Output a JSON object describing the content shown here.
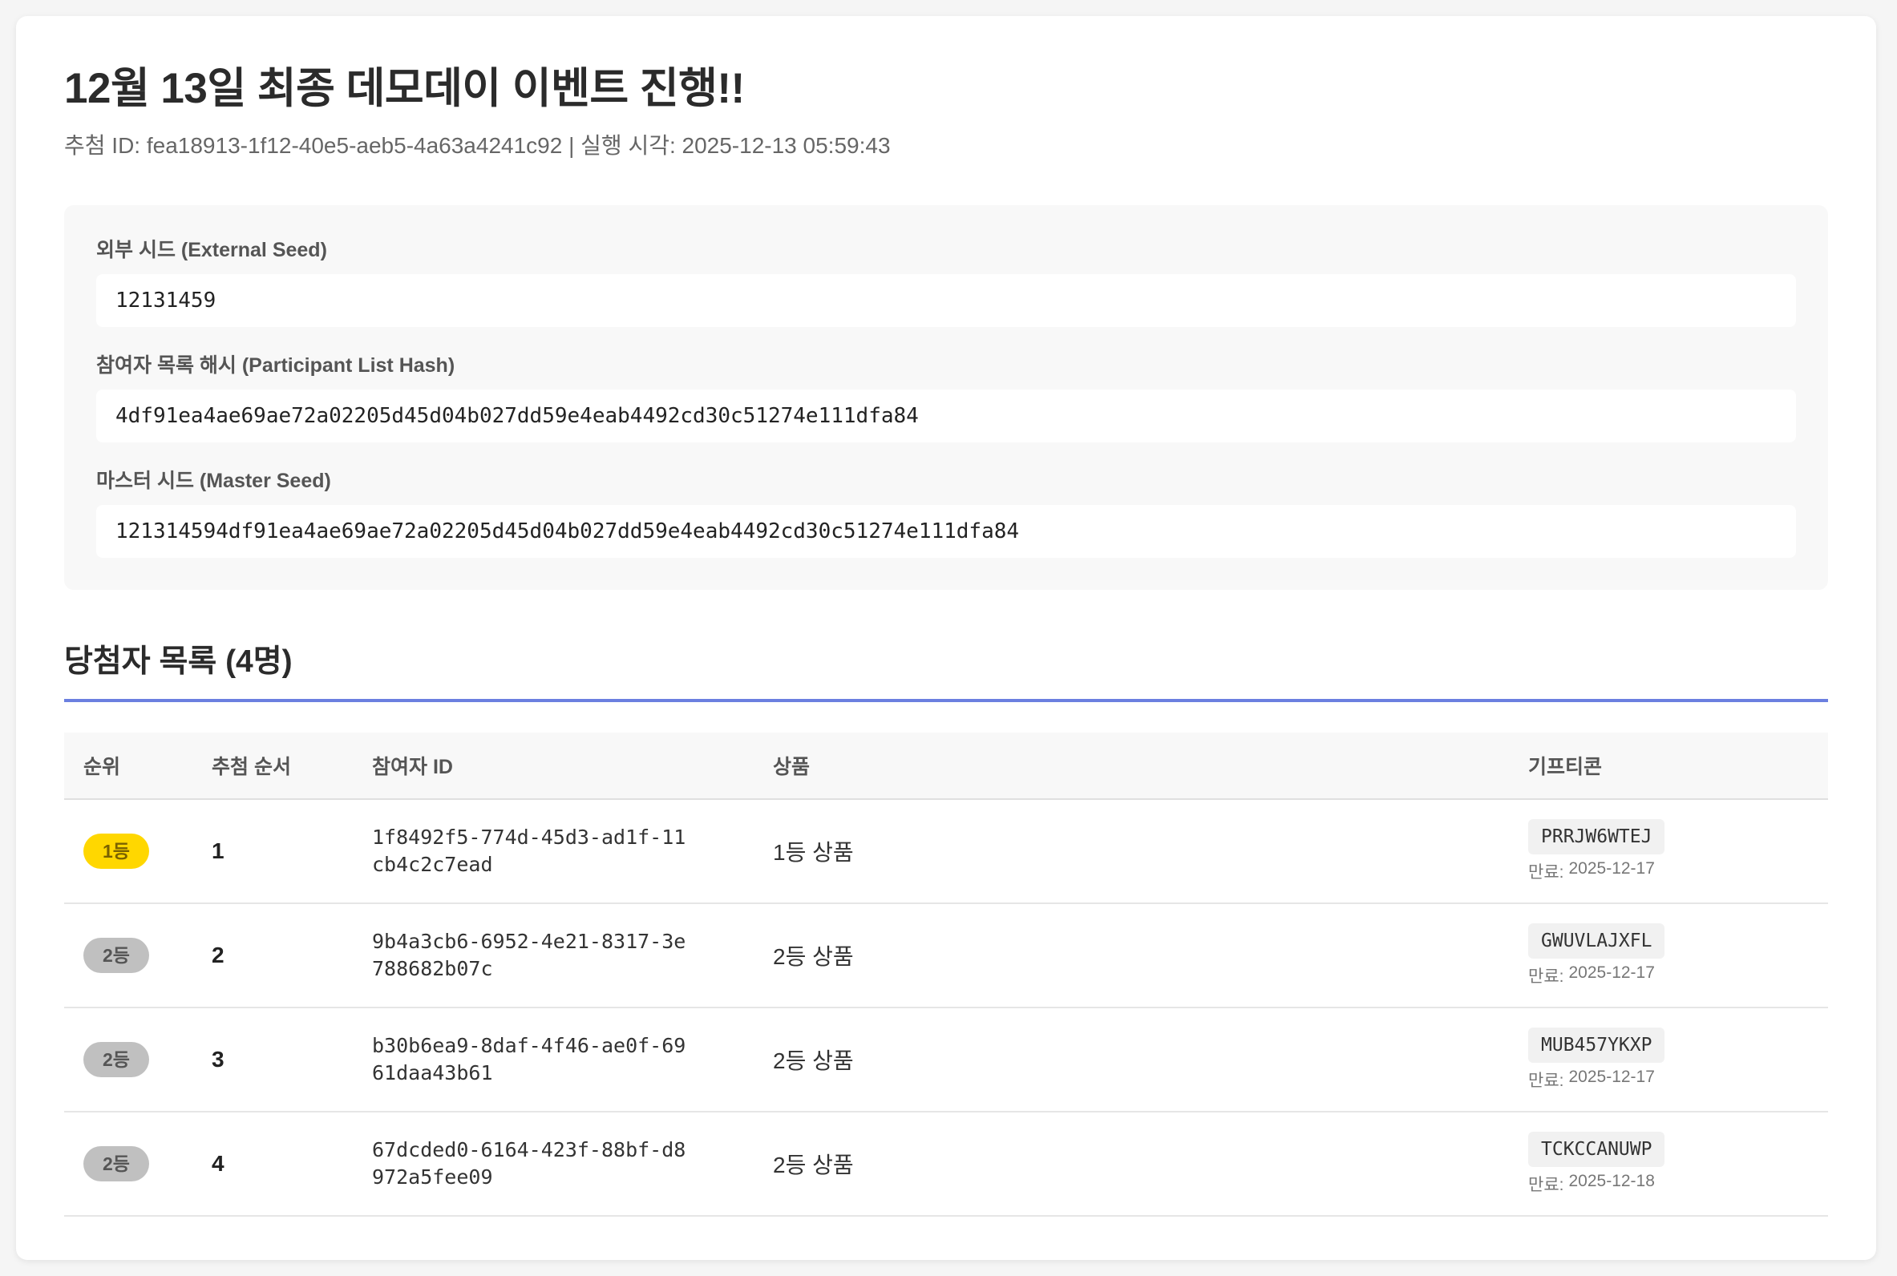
{
  "page": {
    "title": "12월 13일 최종 데모데이 이벤트 진행!!",
    "meta": "추첨 ID: fea18913-1f12-40e5-aeb5-4a63a4241c92 | 실행 시각: 2025-12-13 05:59:43"
  },
  "seeds": {
    "external_label": "외부 시드 (External Seed)",
    "external_value": "12131459",
    "hash_label": "참여자 목록 해시 (Participant List Hash)",
    "hash_value": "4df91ea4ae69ae72a02205d45d04b027dd59e4eab4492cd30c51274e111dfa84",
    "master_label": "마스터 시드 (Master Seed)",
    "master_value": "121314594df91ea4ae69ae72a02205d45d04b027dd59e4eab4492cd30c51274e111dfa84"
  },
  "winners": {
    "title": "당첨자 목록 (4명)",
    "headers": {
      "rank": "순위",
      "order": "추첨 순서",
      "participant_id": "참여자 ID",
      "prize": "상품",
      "gifticon": "기프티콘"
    },
    "expiry_label": "만료:",
    "rows": [
      {
        "rank": "1등",
        "order": "1",
        "participant_id": "1f8492f5-774d-45d3-ad1f-11cb4c2c7ead",
        "prize": "1등 상품",
        "code": "PRRJW6WTEJ",
        "expiry": "2025-12-17"
      },
      {
        "rank": "2등",
        "order": "2",
        "participant_id": "9b4a3cb6-6952-4e21-8317-3e788682b07c",
        "prize": "2등 상품",
        "code": "GWUVLAJXFL",
        "expiry": "2025-12-17"
      },
      {
        "rank": "2등",
        "order": "3",
        "participant_id": "b30b6ea9-8daf-4f46-ae0f-6961daa43b61",
        "prize": "2등 상품",
        "code": "MUB457YKXP",
        "expiry": "2025-12-17"
      },
      {
        "rank": "2등",
        "order": "4",
        "participant_id": "67dcded0-6164-423f-88bf-d8972a5fee09",
        "prize": "2등 상품",
        "code": "TCKCCANUWP",
        "expiry": "2025-12-18"
      }
    ]
  },
  "colors": {
    "accent": "#6b7fe0",
    "gold_badge": "#ffd700",
    "silver_badge": "#c0c0c0"
  }
}
